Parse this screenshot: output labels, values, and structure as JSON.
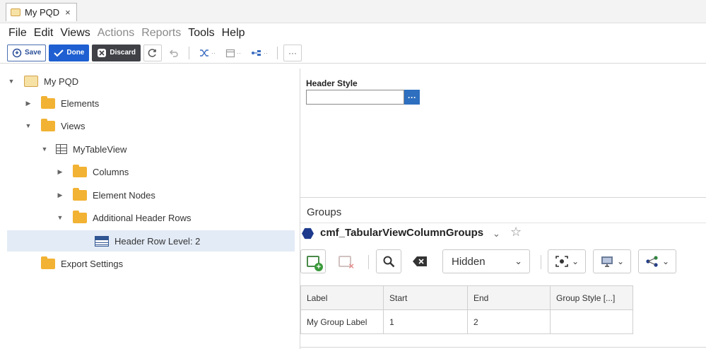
{
  "tab": {
    "title": "My PQD",
    "close": "×"
  },
  "menu": [
    "File",
    "Edit",
    "Views",
    "Actions",
    "Reports",
    "Tools",
    "Help"
  ],
  "menu_disabled": [
    false,
    false,
    false,
    true,
    true,
    false,
    false
  ],
  "toolbar": {
    "save_label": "Save",
    "done_label": "Done",
    "discard_label": "Discard",
    "more": "···"
  },
  "tree": [
    {
      "label": "My PQD",
      "caret": "▼",
      "icon": "pqd-icon"
    },
    {
      "label": "Elements",
      "caret": "▶",
      "icon": "folder-icon"
    },
    {
      "label": "Views",
      "caret": "▼",
      "icon": "folder-icon"
    },
    {
      "label": "MyTableView",
      "caret": "▼",
      "icon": "table-view-icon"
    },
    {
      "label": "Columns",
      "caret": "▶",
      "icon": "folder-icon"
    },
    {
      "label": "Element Nodes",
      "caret": "▶",
      "icon": "folder-icon"
    },
    {
      "label": "Additional Header Rows",
      "caret": "▼",
      "icon": "folder-icon"
    },
    {
      "label": "Header Row Level: 2",
      "caret": "",
      "icon": "header-row-icon"
    },
    {
      "label": "Export Settings",
      "caret": "",
      "icon": "folder-icon"
    }
  ],
  "header_style": {
    "label": "Header Style",
    "value": "",
    "button": "···"
  },
  "groups": {
    "tab_label": "Groups",
    "group_name": "cmf_TabularViewColumnGroups",
    "filter_value": "Hidden",
    "columns": [
      "Label",
      "Start",
      "End",
      "Group Style [...]"
    ],
    "rows": [
      [
        "My Group Label",
        "1",
        "2",
        ""
      ]
    ]
  },
  "colors": {
    "accent": "#1f5fd1",
    "folder": "#f2b233",
    "selected_row": "#e3ebf6",
    "group_icon": "#1d3a8c"
  }
}
